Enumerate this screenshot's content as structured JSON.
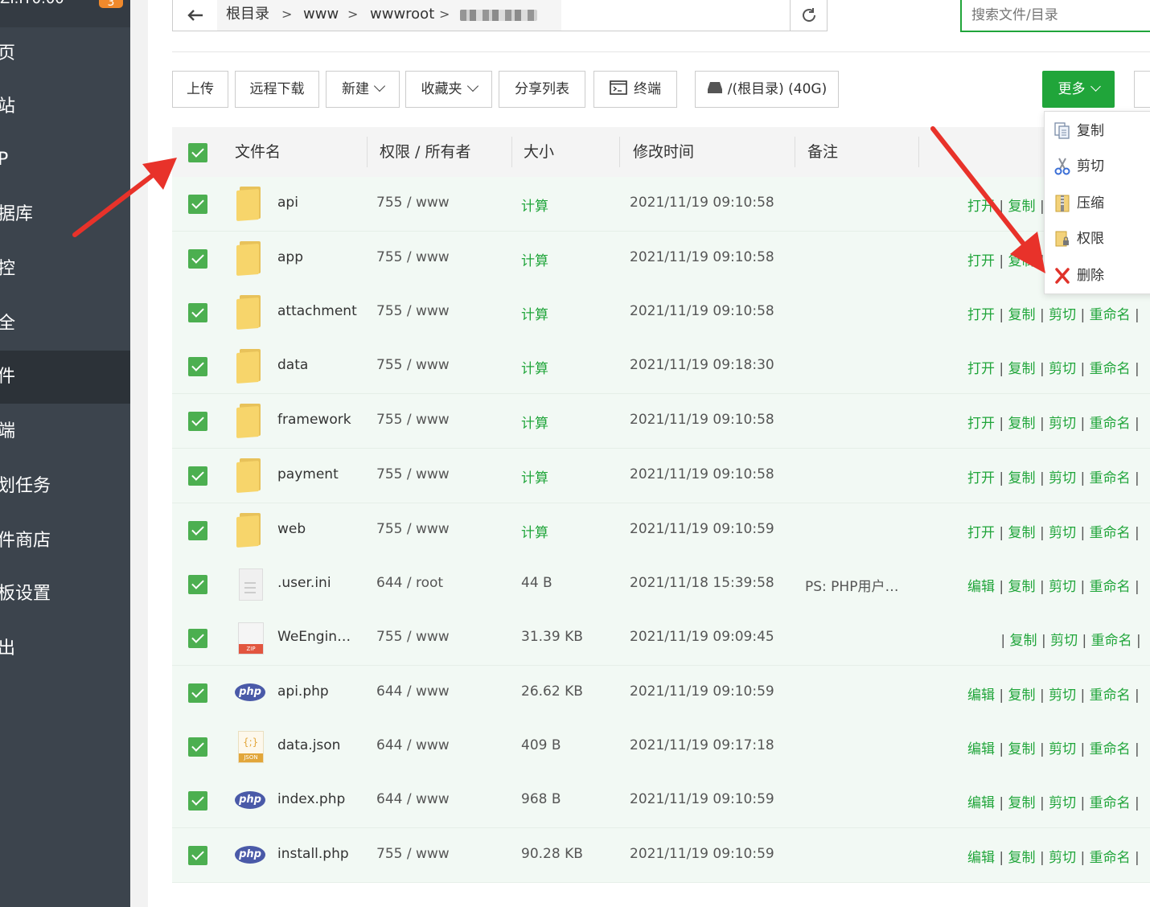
{
  "sidebar": {
    "top_text": "ZI.IT0.00",
    "badge": "3",
    "items": [
      {
        "label": "页"
      },
      {
        "label": "站"
      },
      {
        "label": "P"
      },
      {
        "label": "据库"
      },
      {
        "label": "控"
      },
      {
        "label": "全"
      },
      {
        "label": "件"
      },
      {
        "label": "端"
      },
      {
        "label": "划任务"
      },
      {
        "label": "件商店"
      },
      {
        "label": "板设置"
      },
      {
        "label": "出"
      }
    ],
    "active_index": 6
  },
  "address": {
    "back_icon": "arrow-left-icon",
    "segments": [
      "根目录",
      "www",
      "wwwroot"
    ],
    "refresh_icon": "refresh-icon",
    "search_placeholder": "搜索文件/目录"
  },
  "toolbar": {
    "upload": "上传",
    "remote_download": "远程下载",
    "new": "新建",
    "favorites": "收藏夹",
    "share_list": "分享列表",
    "terminal": "终端",
    "disk": "/(根目录) (40G)",
    "more": "更多"
  },
  "table": {
    "headers": {
      "name": "文件名",
      "perm": "权限 / 所有者",
      "size": "大小",
      "mtime": "修改时间",
      "note": "备注"
    },
    "rows": [
      {
        "icon": "folder-icon",
        "name": "api",
        "perm": "755 / www",
        "size": "计算",
        "mtime": "2021/11/19 09:10:58",
        "note": "",
        "ops": [
          "打开",
          "复制"
        ]
      },
      {
        "icon": "folder-icon",
        "name": "app",
        "perm": "755 / www",
        "size": "计算",
        "mtime": "2021/11/19 09:10:58",
        "note": "",
        "ops": [
          "打开",
          "复制"
        ]
      },
      {
        "icon": "folder-icon",
        "name": "attachment",
        "perm": "755 / www",
        "size": "计算",
        "mtime": "2021/11/19 09:10:58",
        "note": "",
        "ops": [
          "打开",
          "复制",
          "剪切",
          "重命名"
        ]
      },
      {
        "icon": "folder-icon",
        "name": "data",
        "perm": "755 / www",
        "size": "计算",
        "mtime": "2021/11/19 09:18:30",
        "note": "",
        "ops": [
          "打开",
          "复制",
          "剪切",
          "重命名"
        ]
      },
      {
        "icon": "folder-icon",
        "name": "framework",
        "perm": "755 / www",
        "size": "计算",
        "mtime": "2021/11/19 09:10:58",
        "note": "",
        "ops": [
          "打开",
          "复制",
          "剪切",
          "重命名"
        ]
      },
      {
        "icon": "folder-icon",
        "name": "payment",
        "perm": "755 / www",
        "size": "计算",
        "mtime": "2021/11/19 09:10:58",
        "note": "",
        "ops": [
          "打开",
          "复制",
          "剪切",
          "重命名"
        ]
      },
      {
        "icon": "folder-icon",
        "name": "web",
        "perm": "755 / www",
        "size": "计算",
        "mtime": "2021/11/19 09:10:59",
        "note": "",
        "ops": [
          "打开",
          "复制",
          "剪切",
          "重命名"
        ]
      },
      {
        "icon": "file-icon",
        "name": ".user.ini",
        "perm": "644 / root",
        "size": "44 B",
        "mtime": "2021/11/18 15:39:58",
        "note": "PS: PHP用户…",
        "ops": [
          "编辑",
          "复制",
          "剪切",
          "重命名"
        ]
      },
      {
        "icon": "zip-icon",
        "name": "WeEngin…",
        "perm": "755 / www",
        "size": "31.39 KB",
        "mtime": "2021/11/19 09:09:45",
        "note": "",
        "ops": [
          "",
          "复制",
          "剪切",
          "重命名"
        ]
      },
      {
        "icon": "php-icon",
        "name": "api.php",
        "perm": "644 / www",
        "size": "26.62 KB",
        "mtime": "2021/11/19 09:10:59",
        "note": "",
        "ops": [
          "编辑",
          "复制",
          "剪切",
          "重命名"
        ]
      },
      {
        "icon": "json-icon",
        "name": "data.json",
        "perm": "644 / www",
        "size": "409 B",
        "mtime": "2021/11/19 09:17:18",
        "note": "",
        "ops": [
          "编辑",
          "复制",
          "剪切",
          "重命名"
        ]
      },
      {
        "icon": "php-icon",
        "name": "index.php",
        "perm": "644 / www",
        "size": "968 B",
        "mtime": "2021/11/19 09:10:59",
        "note": "",
        "ops": [
          "编辑",
          "复制",
          "剪切",
          "重命名"
        ]
      },
      {
        "icon": "php-icon",
        "name": "install.php",
        "perm": "755 / www",
        "size": "90.28 KB",
        "mtime": "2021/11/19 09:10:59",
        "note": "",
        "ops": [
          "编辑",
          "复制",
          "剪切",
          "重命名"
        ]
      }
    ]
  },
  "icon_labels": {
    "php": "php",
    "zip": "ZIP",
    "json": "JSON"
  },
  "more_menu": [
    {
      "icon": "copy-icon",
      "label": "复制"
    },
    {
      "icon": "scissors-icon",
      "label": "剪切"
    },
    {
      "icon": "zip-archive-icon",
      "label": "压缩"
    },
    {
      "icon": "permission-icon",
      "label": "权限"
    },
    {
      "icon": "delete-icon",
      "label": "删除"
    }
  ],
  "colors": {
    "accent": "#20a53a",
    "sidebar": "#3c444d",
    "annotation": "#e8322a",
    "row_bg": "#f2f9f4"
  }
}
